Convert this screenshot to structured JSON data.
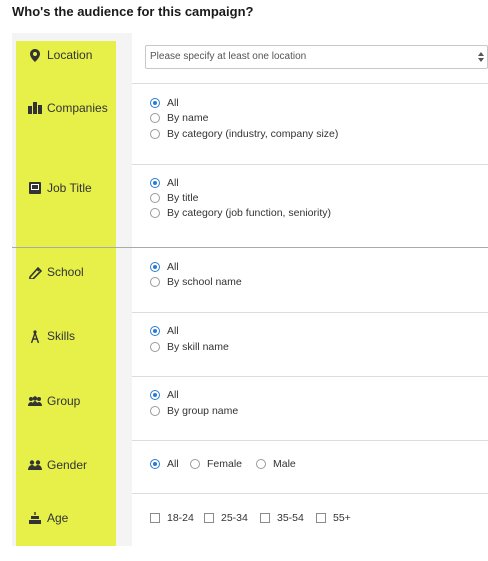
{
  "heading": "Who's the audience for this campaign?",
  "location": {
    "label": "Location",
    "icon": "location-pin-icon",
    "placeholder": "Please specify at least one location"
  },
  "companies": {
    "label": "Companies",
    "icon": "buildings-icon",
    "options": [
      "All",
      "By name",
      "By category (industry, company size)"
    ],
    "selected": 0
  },
  "job_title": {
    "label": "Job Title",
    "icon": "briefcase-icon",
    "options": [
      "All",
      "By title",
      "By category (job function, seniority)"
    ],
    "selected": 0
  },
  "school": {
    "label": "School",
    "icon": "diploma-icon",
    "options": [
      "All",
      "By school name"
    ],
    "selected": 0
  },
  "skills": {
    "label": "Skills",
    "icon": "compass-icon",
    "options": [
      "All",
      "By skill name"
    ],
    "selected": 0
  },
  "group": {
    "label": "Group",
    "icon": "group-icon",
    "options": [
      "All",
      "By group name"
    ],
    "selected": 0
  },
  "gender": {
    "label": "Gender",
    "icon": "people-icon",
    "options": [
      "All",
      "Female",
      "Male"
    ],
    "selected": 0
  },
  "age": {
    "label": "Age",
    "icon": "cake-icon",
    "options": [
      "18-24",
      "25-34",
      "35-54",
      "55+"
    ]
  },
  "colors": {
    "highlight": "#e6f049",
    "accent": "#2b7bd3"
  }
}
